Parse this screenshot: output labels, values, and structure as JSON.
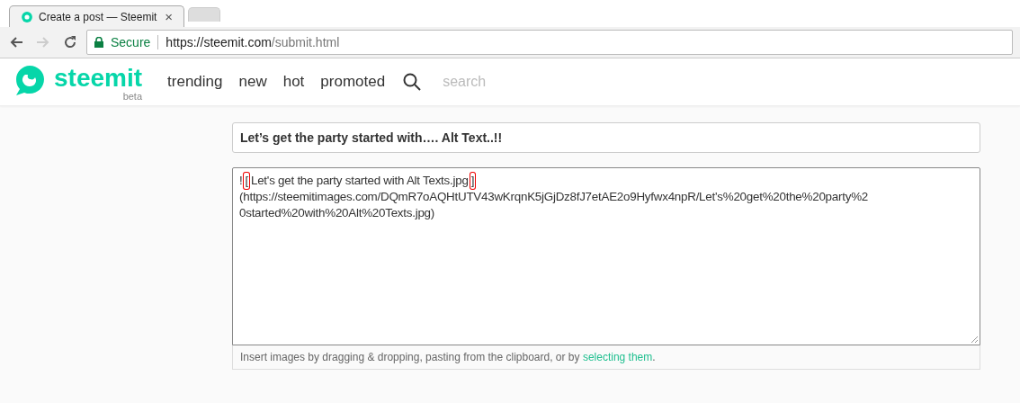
{
  "browser": {
    "tabs": [
      {
        "title": "Create a post — Steemit",
        "selected": true,
        "close": "×"
      },
      {
        "selected": false
      }
    ],
    "security": "Secure",
    "url_host": "https://steemit.com",
    "url_path": "/submit.html",
    "back_enabled": true,
    "forward_enabled": false
  },
  "header": {
    "logo": "steemit",
    "logo_sub": "beta",
    "nav": [
      "trending",
      "new",
      "hot",
      "promoted"
    ],
    "search": {
      "placeholder": "search"
    }
  },
  "title_field": {
    "value": "Let’s get the party started with…. Alt Text..!!"
  },
  "body_field": {
    "lines": [
      [
        {
          "text": "!",
          "marked": false
        },
        {
          "text": "[",
          "marked": true
        },
        {
          "text": "Let's get the party started with Alt Texts.jpg",
          "marked": false
        },
        {
          "text": "]",
          "marked": true
        }
      ],
      [
        {
          "text": "(https://steemitimages.com/DQmR7oAQHtUTV43wKrqnK5jGjDz8fJ7etAE2o9Hyfwx4npR/Let's%20get%20the%20party%2",
          "marked": false
        }
      ],
      [
        {
          "text": "0started%20with%20Alt%20Texts.jpg)",
          "marked": false
        }
      ]
    ]
  },
  "hint": {
    "text": "Insert images by dragging & dropping, pasting from the clipboard, or by ",
    "link": "selecting them",
    "end": "."
  }
}
